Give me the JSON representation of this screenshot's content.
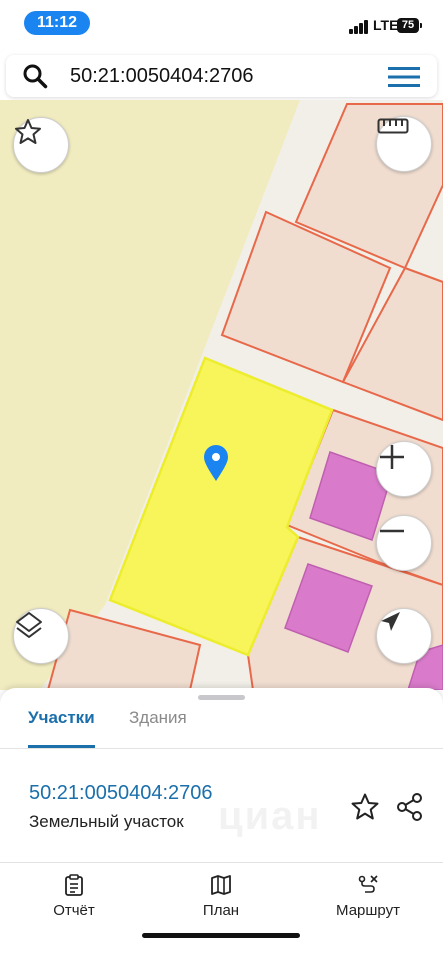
{
  "status_bar": {
    "time": "11:12",
    "network": "LTE",
    "battery": "75"
  },
  "search": {
    "value": "50:21:0050404:2706"
  },
  "map": {
    "colors": {
      "background": "#f1ecc0",
      "road": "#f1efe8",
      "parcel_fill": "#f0ddd0",
      "parcel_stroke": "#e8684a",
      "selected_fill": "#f7f55a",
      "selected_stroke": "#eded2e",
      "building_fill": "#d97bca",
      "pin": "#1a84f0"
    },
    "icons": [
      "star-icon",
      "ruler-icon",
      "zoom-in-icon",
      "zoom-out-icon",
      "layers-icon",
      "locate-icon",
      "location-pin-icon"
    ]
  },
  "sheet": {
    "tabs": [
      {
        "label": "Участки",
        "active": true
      },
      {
        "label": "Здания",
        "active": false
      }
    ],
    "result": {
      "cadastral_number": "50:21:0050404:2706",
      "type": "Земельный участок",
      "watermark": "циан"
    },
    "toolbar": [
      {
        "label": "Отчёт",
        "icon": "report-icon"
      },
      {
        "label": "План",
        "icon": "map-plan-icon"
      },
      {
        "label": "Маршрут",
        "icon": "route-icon"
      }
    ]
  }
}
